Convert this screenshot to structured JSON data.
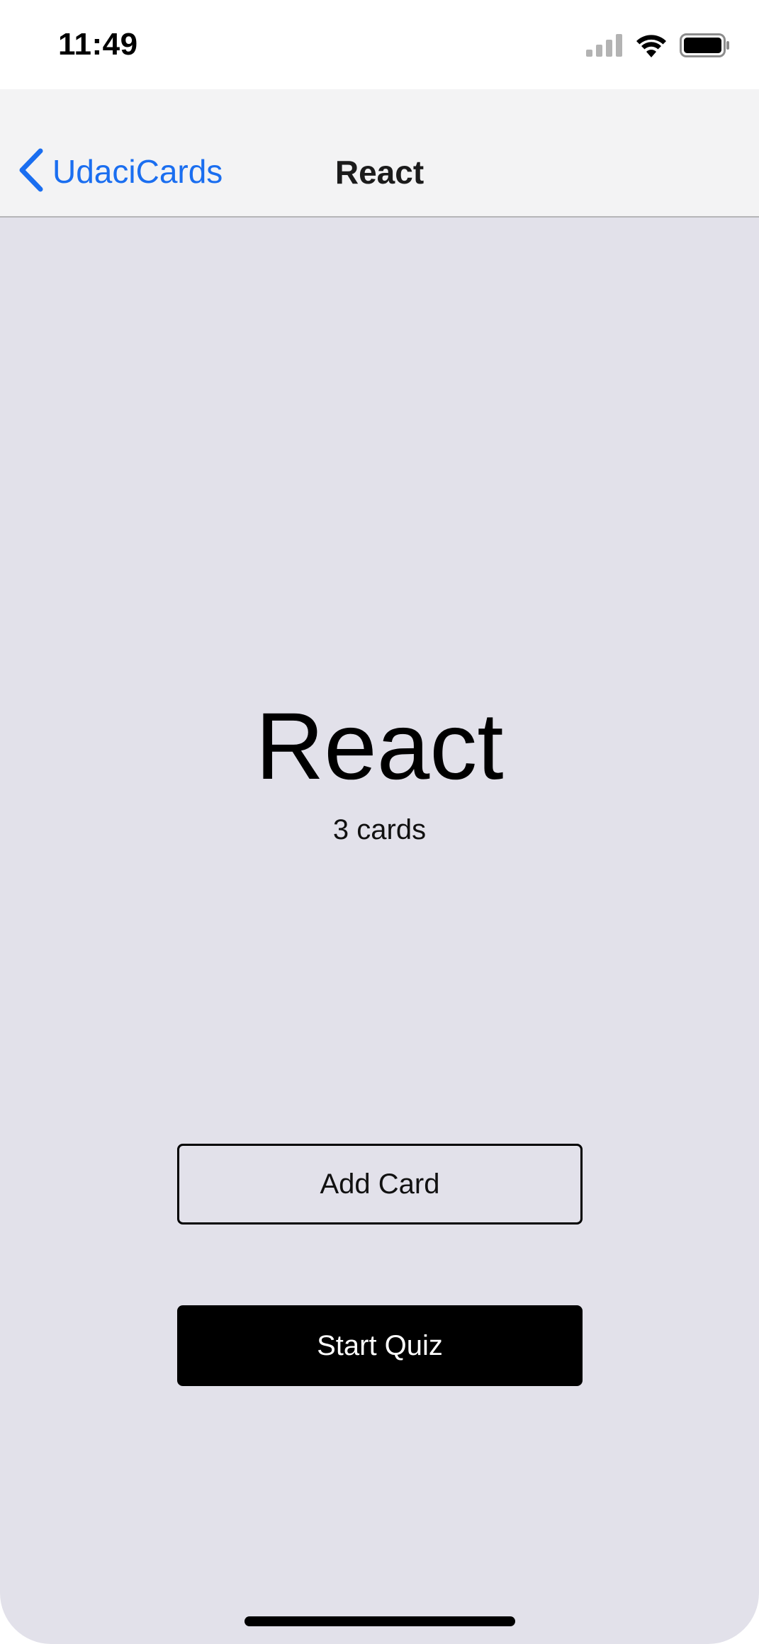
{
  "status_bar": {
    "time": "11:49",
    "icons": [
      "cellular-signal-icon",
      "wifi-icon",
      "battery-icon"
    ]
  },
  "nav": {
    "back_label": "UdaciCards",
    "title": "React",
    "accent_color": "#1a6ef0"
  },
  "deck": {
    "title": "React",
    "count_text": "3 cards"
  },
  "actions": {
    "add_card_label": "Add Card",
    "start_quiz_label": "Start Quiz"
  },
  "colors": {
    "background": "#e2e1ea",
    "nav_background": "#f3f3f4",
    "primary_button": "#000000"
  }
}
